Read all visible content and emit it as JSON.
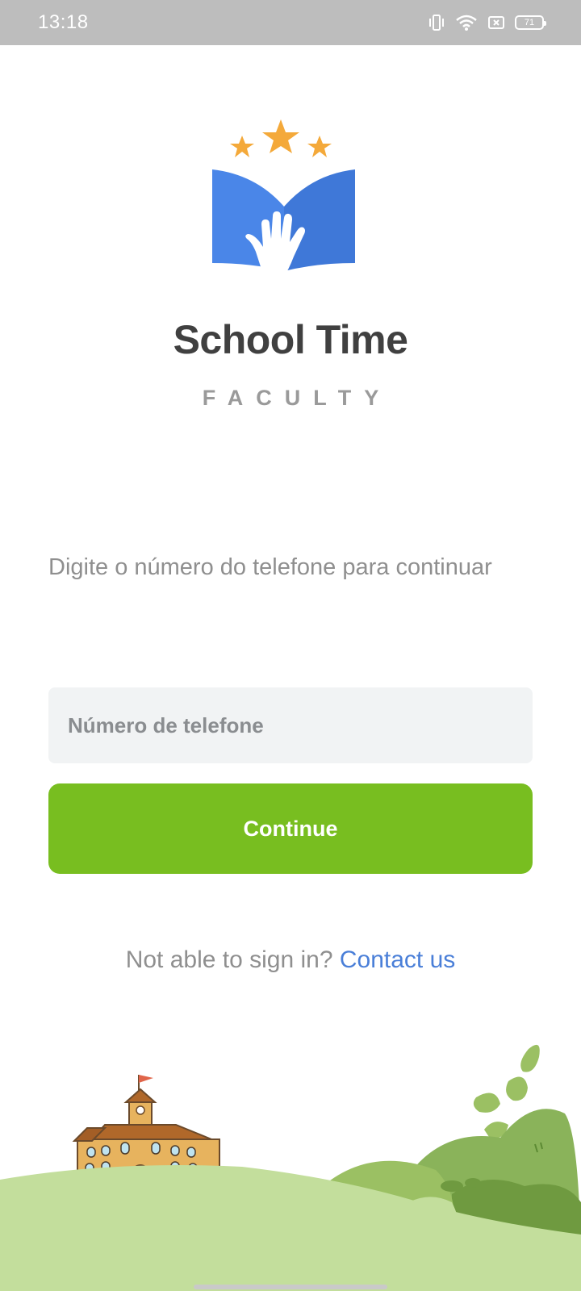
{
  "status_bar": {
    "time": "13:18",
    "battery": "71",
    "icons": [
      "vibrate-icon",
      "wifi-icon",
      "sim-off-icon",
      "battery-icon"
    ]
  },
  "brand": {
    "title": "School Time",
    "subtitle": "FACULTY",
    "logo_icon": "book-hand-stars-logo"
  },
  "login": {
    "prompt": "Digite o número do telefone para continuar",
    "phone_placeholder": "Número de telefone",
    "phone_value": "",
    "continue_label": "Continue"
  },
  "help": {
    "text": "Not able to sign in?",
    "link_label": "Contact us"
  },
  "colors": {
    "accent_green": "#78be20",
    "link_blue": "#4a7fd8",
    "book_blue": "#4a86e8",
    "star_orange": "#f4a93a",
    "status_bar": "#bdbdbd"
  }
}
